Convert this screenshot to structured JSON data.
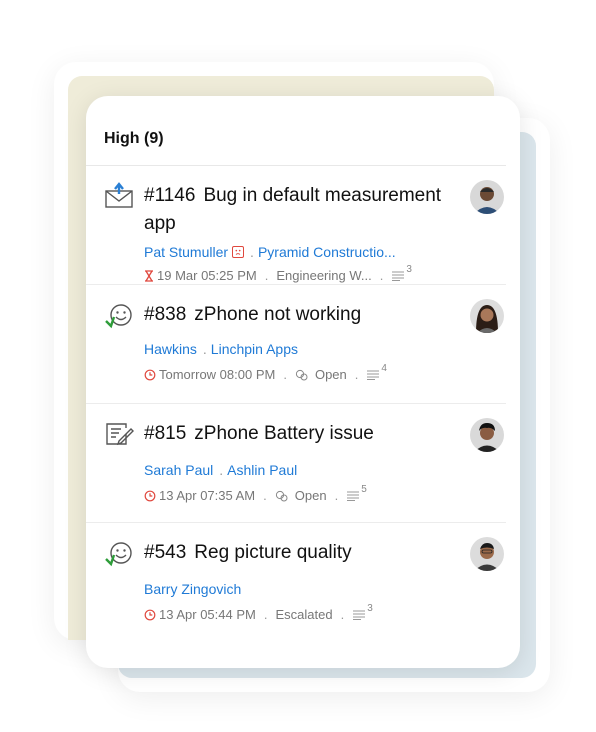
{
  "group": {
    "title": "High (9)"
  },
  "tickets": [
    {
      "number": "#1146",
      "subject": "Bug in default measurement app",
      "contact": "Pat Stumuller",
      "account": "Pyramid Constructio...",
      "due": "19 Mar 05:25 PM",
      "status": "Engineering W...",
      "threads": "3",
      "icon": "email-icon"
    },
    {
      "number": "#838",
      "subject": "zPhone not working",
      "contact": "Hawkins",
      "account": "Linchpin Apps",
      "due": "Tomorrow 08:00 PM",
      "status": "Open",
      "threads": "4",
      "icon": "happy-customer-icon"
    },
    {
      "number": "#815",
      "subject": "zPhone Battery issue",
      "contact": "Sarah Paul",
      "account": "Ashlin Paul",
      "due": "13 Apr 07:35 AM",
      "status": "Open",
      "threads": "5",
      "icon": "web-form-icon"
    },
    {
      "number": "#543",
      "subject": "Reg picture quality",
      "contact": "Barry Zingovich",
      "due": "13 Apr 05:44 PM",
      "status": "Escalated",
      "threads": "3",
      "icon": "happy-customer-icon"
    }
  ],
  "colors": {
    "link": "#1f7ad6",
    "overdue": "#e0483e",
    "text": "#111111",
    "meta": "#777777"
  }
}
